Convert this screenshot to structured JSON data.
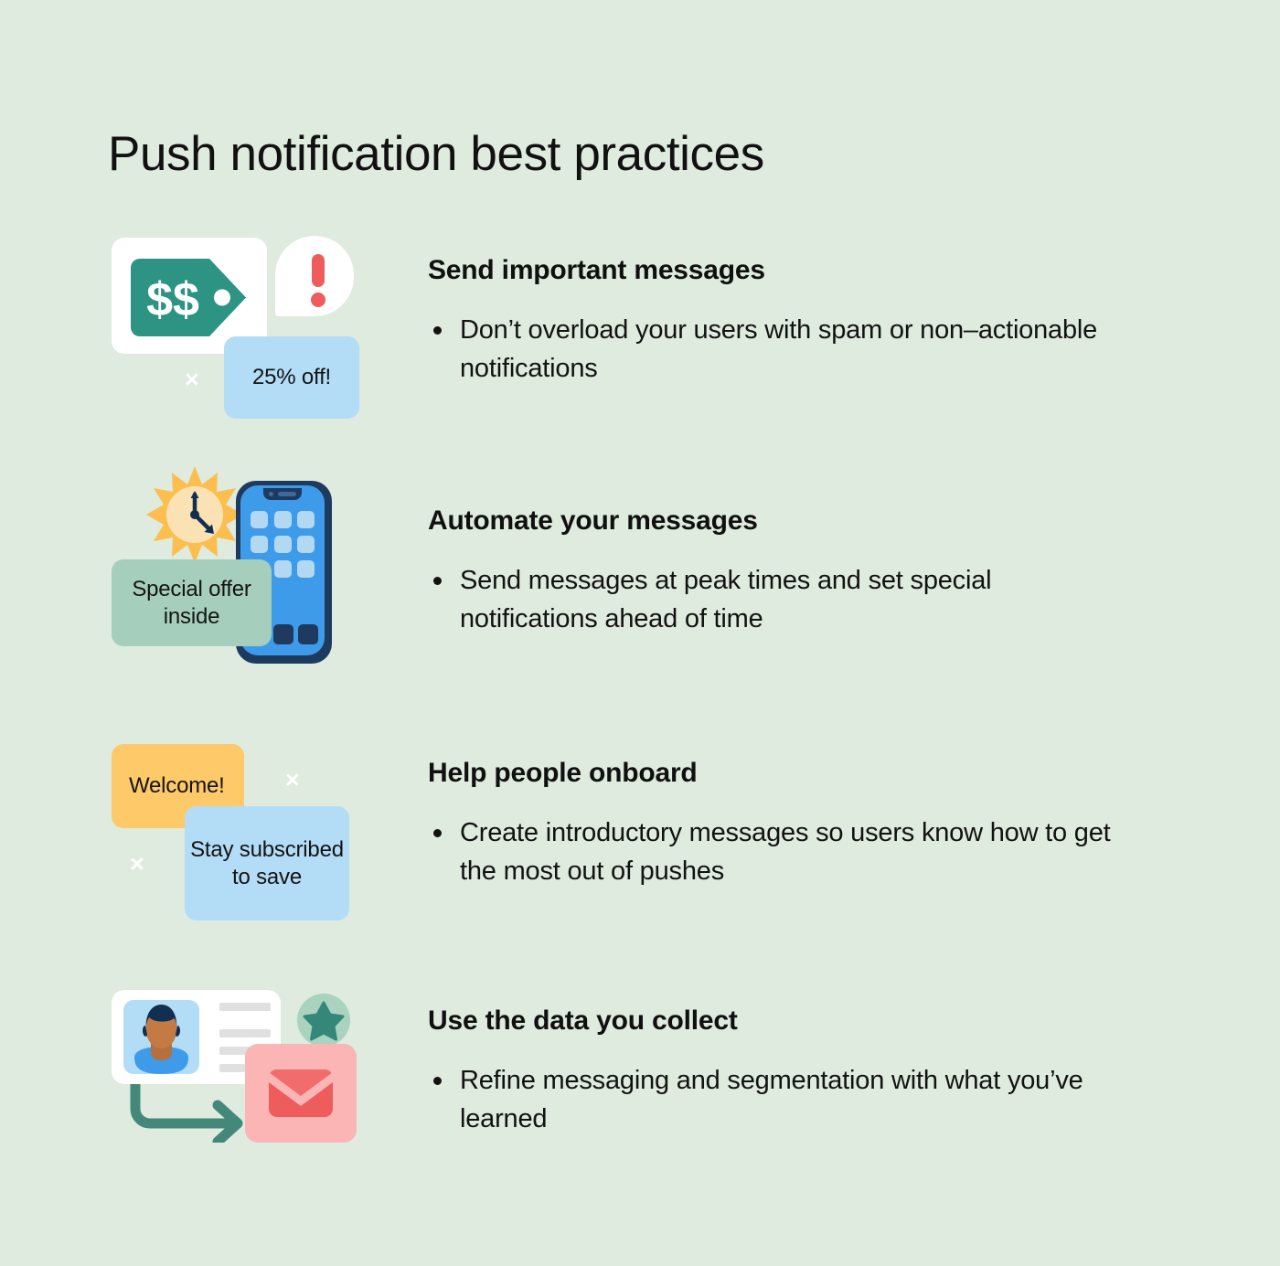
{
  "theme": {
    "background": "#deebde",
    "teal": "#2d9383",
    "red": "#ee5c5c",
    "light_blue": "#b3ddf7",
    "sage": "#a5cfbc",
    "amber": "#fdc969",
    "pink": "#fcb5b5",
    "navy": "#1e3a5f",
    "phone_blue": "#3d9be9",
    "sun_ray": "#fcbe4e",
    "sun_face": "#fbe2b4",
    "star_circle": "#a9d3be",
    "star": "#35877a",
    "text": "#111111"
  },
  "header": {
    "title": "Push notification best practices"
  },
  "sections": [
    {
      "heading": "Send important messages",
      "bullets": [
        "Don’t overload your users with spam or non–actionable notifications"
      ],
      "art": {
        "tag_label": "$$",
        "alert_icon": "exclamation-icon",
        "promo_card_label": "25% off!",
        "dismiss_marks": [
          "×"
        ]
      }
    },
    {
      "heading": "Automate your messages",
      "bullets": [
        "Send messages at peak times and set special notifications ahead of time"
      ],
      "art": {
        "sun_clock_icon": "sun-clock-icon",
        "phone_icon": "smartphone-icon",
        "message_card_label": "Special offer inside"
      }
    },
    {
      "heading": "Help people onboard",
      "bullets": [
        "Create introductory messages so users know how to get the most out of pushes"
      ],
      "art": {
        "welcome_card_label": "Welcome!",
        "subscribe_card_label": "Stay subscribed to save",
        "dismiss_marks": [
          "×",
          "×"
        ]
      }
    },
    {
      "heading": "Use the data you collect",
      "bullets": [
        "Refine messaging and segmentation with what you’ve learned"
      ],
      "art": {
        "profile_card_icon": "profile-card-icon",
        "star_badge_icon": "star-icon",
        "arrow_icon": "curved-arrow-icon",
        "envelope_icon": "envelope-icon"
      }
    }
  ]
}
